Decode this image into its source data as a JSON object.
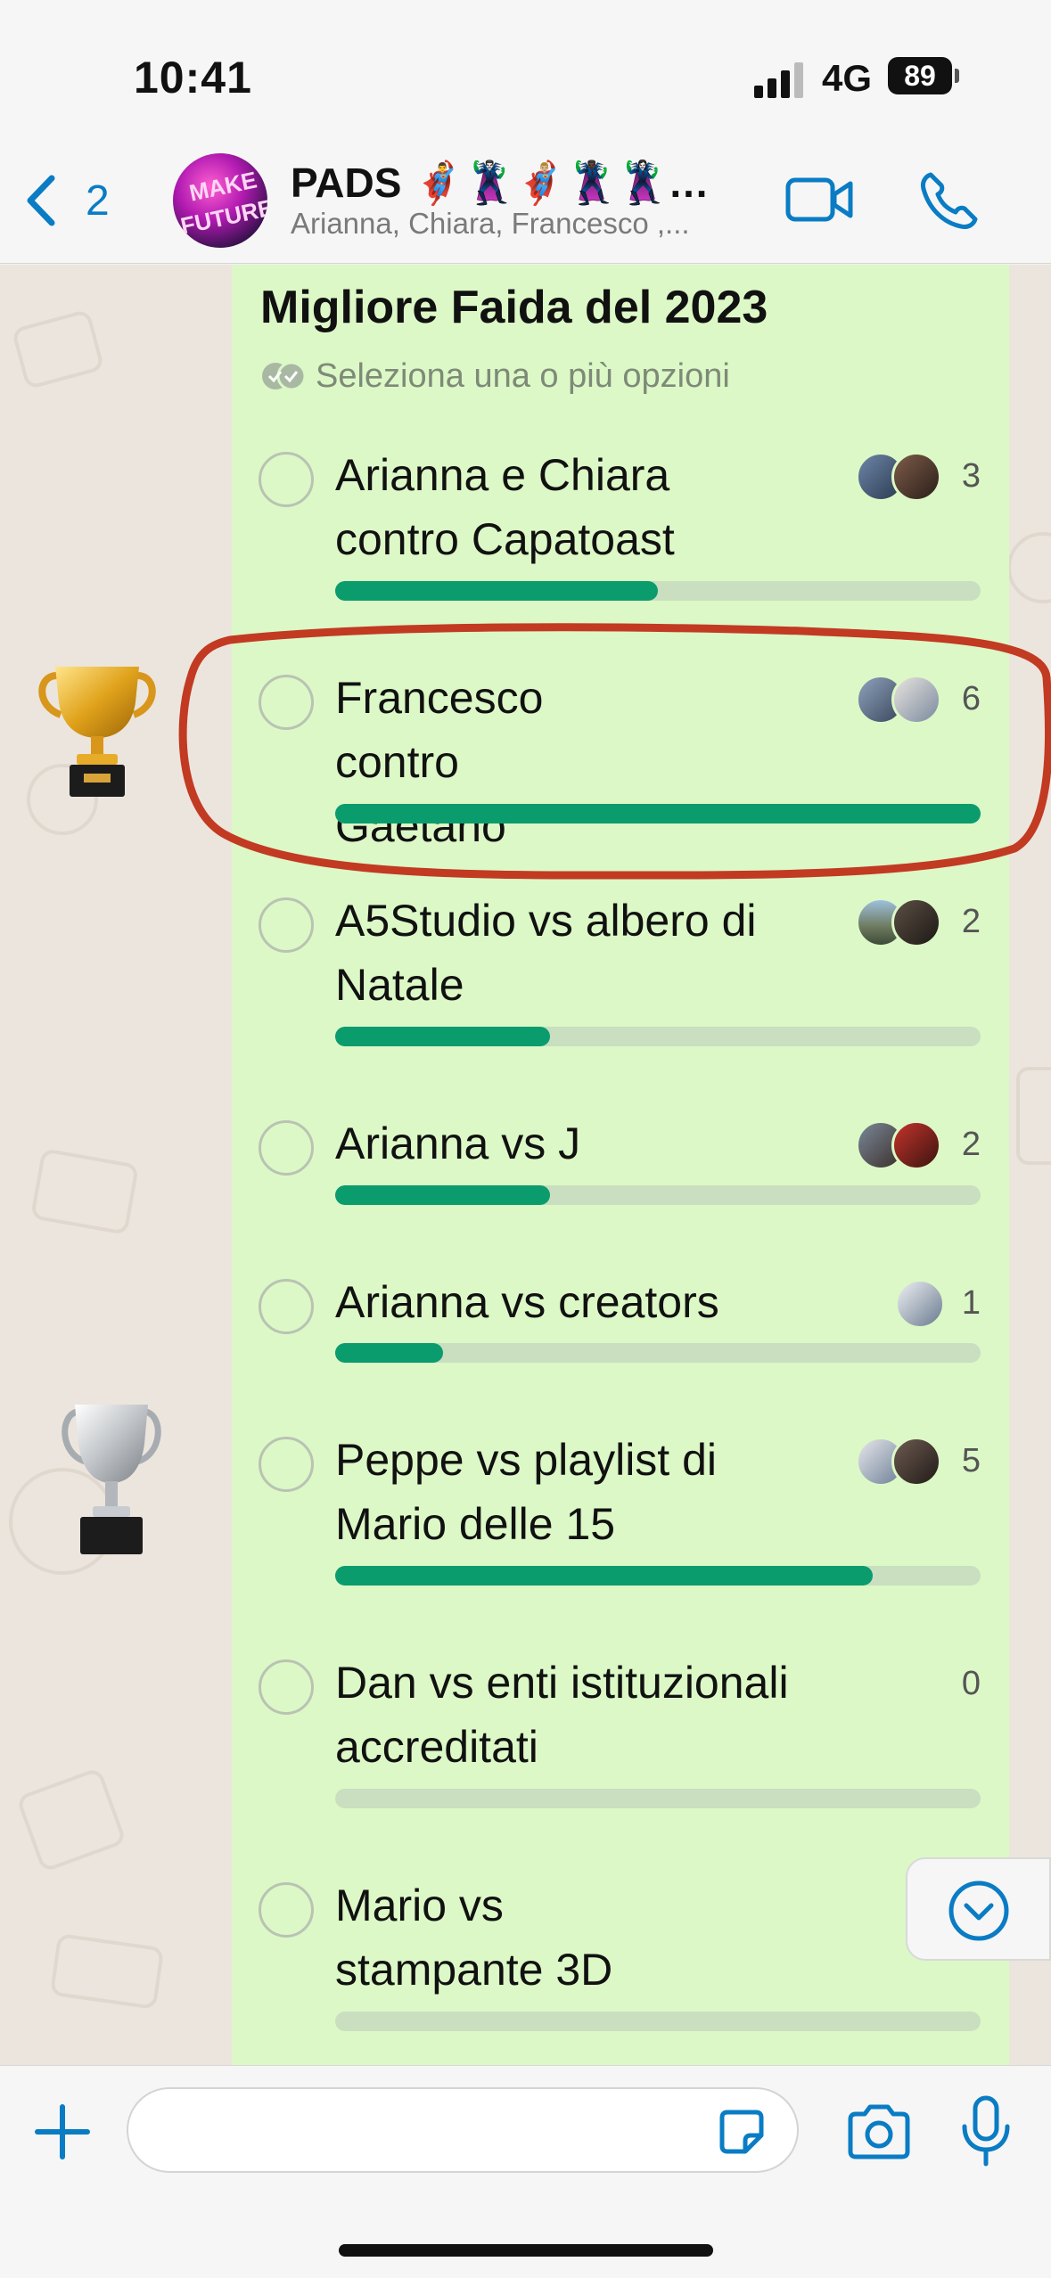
{
  "status_bar": {
    "time": "10:41",
    "network": "4G",
    "battery": "89"
  },
  "header": {
    "back_count": "2",
    "group_name": "PADS 🦸‍♂️🦹‍♂️🦸🏼‍♂️🦹🏿‍♂️🦹‍♀️…",
    "members": "Arianna, Chiara, Francesco ,...",
    "avatar_text": [
      "MAKE",
      "FUTURE"
    ]
  },
  "poll": {
    "title": "Migliore Faida del 2023",
    "hint": "Seleziona una o più opzioni",
    "max_votes": 6,
    "options": [
      {
        "label": "Arianna e Chiara contro Capatoast",
        "votes": "3",
        "fraction": 0.5
      },
      {
        "label": "Francesco contro Gaetano",
        "votes": "6",
        "fraction": 1.0
      },
      {
        "label": "A5Studio vs albero di Natale",
        "votes": "2",
        "fraction": 0.333
      },
      {
        "label": "Arianna vs J",
        "votes": "2",
        "fraction": 0.333
      },
      {
        "label": "Arianna vs creators",
        "votes": "1",
        "fraction": 0.167
      },
      {
        "label": "Peppe vs playlist di Mario delle 15",
        "votes": "5",
        "fraction": 0.833
      },
      {
        "label": "Dan vs enti istituzionali accreditati",
        "votes": "0",
        "fraction": 0
      },
      {
        "label": "Mario vs stampante 3D",
        "votes": "",
        "fraction": 0
      }
    ]
  },
  "annotations": {
    "circle_color": "#c23a22",
    "highlighted_option": "Francesco contro Gaetano"
  },
  "input": {
    "placeholder": "",
    "value": ""
  },
  "colors": {
    "accent": "#0a7cc4",
    "poll_bubble": "#dcf8c6",
    "bar_fill": "#0b9c6e",
    "bar_track": "#c9dfc0"
  }
}
